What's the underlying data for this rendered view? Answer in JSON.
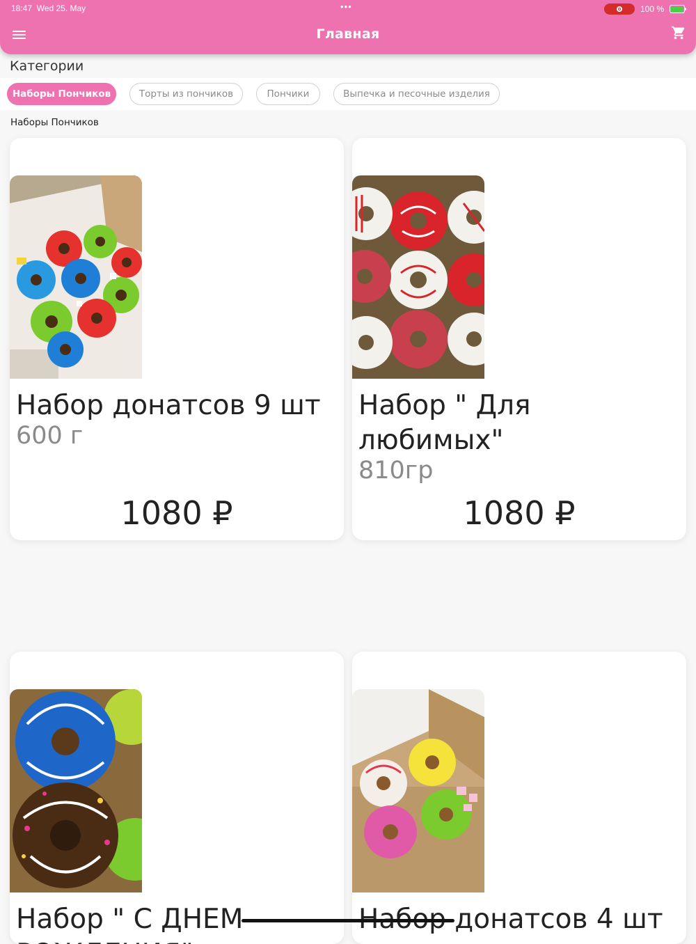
{
  "status_bar": {
    "time": "18:47",
    "date": "Wed 25. May",
    "battery": "100 %"
  },
  "header": {
    "title": "Главная"
  },
  "categories": {
    "heading": "Категории",
    "chips": [
      "Наборы Пончиков",
      "Торты из пончиков",
      "Пончики",
      "Выпечка и песочные изделия"
    ],
    "selected": "Наборы Пончиков"
  },
  "section": {
    "title": "Наборы Пончиков"
  },
  "products": [
    {
      "name": "Набор донатсов 9 шт",
      "weight": "600 г",
      "price": "1080 ₽"
    },
    {
      "name": "Набор \" Для любимых\"",
      "weight": "810гр",
      "price": "1080 ₽"
    },
    {
      "name": "Набор \" С ДНЕМ РОЖДЕНИЯ\"",
      "weight": "",
      "price": ""
    },
    {
      "name": "Набор донатсов 4 шт",
      "weight": "",
      "price": ""
    }
  ],
  "colors": {
    "accent": "#ef72b0",
    "background": "#f7f7f7",
    "muted_text": "#8a8a8a"
  }
}
